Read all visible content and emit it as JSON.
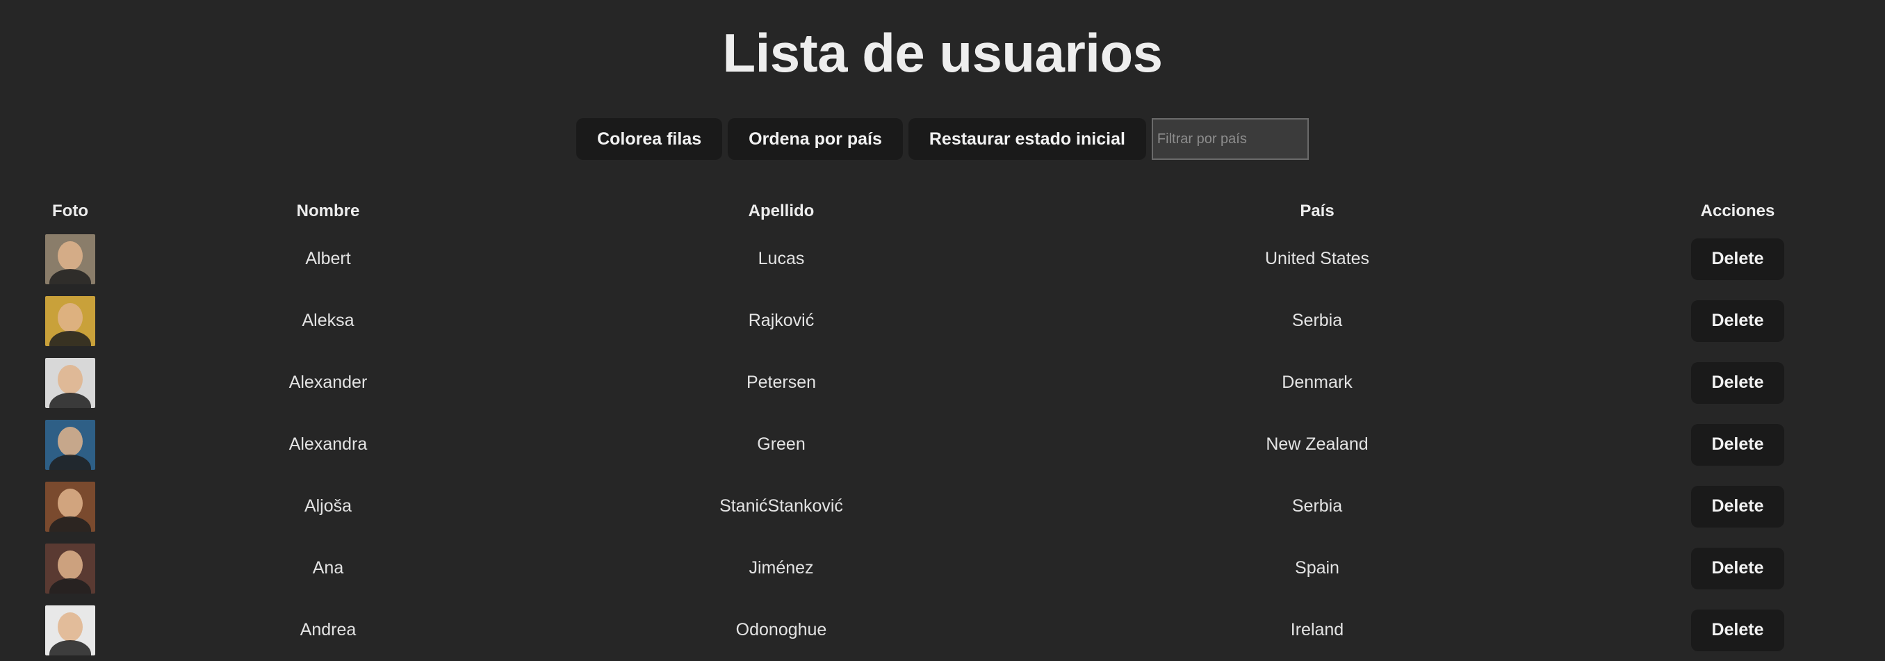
{
  "page": {
    "title": "Lista de usuarios"
  },
  "toolbar": {
    "color_rows_label": "Colorea filas",
    "sort_country_label": "Ordena por país",
    "reset_label": "Restaurar estado inicial",
    "filter_placeholder": "Filtrar por país",
    "filter_value": ""
  },
  "table": {
    "headers": {
      "photo": "Foto",
      "first": "Nombre",
      "last": "Apellido",
      "country": "País",
      "actions": "Acciones"
    },
    "delete_label": "Delete",
    "rows": [
      {
        "first": "Albert",
        "last": "Lucas",
        "country": "United States",
        "photo_color": "#8a7d6a"
      },
      {
        "first": "Aleksa",
        "last": "Rajković",
        "country": "Serbia",
        "photo_color": "#c9a13a"
      },
      {
        "first": "Alexander",
        "last": "Petersen",
        "country": "Denmark",
        "photo_color": "#d8d8d8"
      },
      {
        "first": "Alexandra",
        "last": "Green",
        "country": "New Zealand",
        "photo_color": "#2e5f86"
      },
      {
        "first": "Aljoša",
        "last": "StanićStanković",
        "country": "Serbia",
        "photo_color": "#7a4a2e"
      },
      {
        "first": "Ana",
        "last": "Jiménez",
        "country": "Spain",
        "photo_color": "#5a3a32"
      },
      {
        "first": "Andrea",
        "last": "Odonoghue",
        "country": "Ireland",
        "photo_color": "#e8e8e8"
      }
    ]
  }
}
